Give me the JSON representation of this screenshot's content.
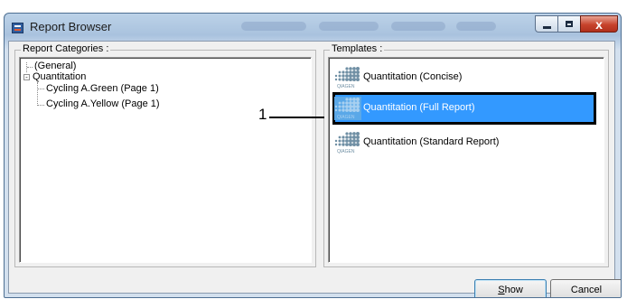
{
  "window": {
    "title": "Report Browser",
    "close_glyph": "x"
  },
  "categories": {
    "legend": "Report Categories :",
    "items": [
      {
        "label": "(General)"
      },
      {
        "label": "Quantitation",
        "expander": "-"
      },
      {
        "label": "Cycling A.Green (Page 1)"
      },
      {
        "label": "Cycling A.Yellow (Page 1)"
      }
    ]
  },
  "templates": {
    "legend": "Templates :",
    "items": [
      {
        "label": "Quantitation (Concise)",
        "selected": false,
        "logo": "QIAGEN"
      },
      {
        "label": "Quantitation (Full Report)",
        "selected": true,
        "logo": "QIAGEN"
      },
      {
        "label": "Quantitation (Standard Report)",
        "selected": false,
        "logo": "QIAGEN"
      }
    ]
  },
  "callout": {
    "number": "1"
  },
  "buttons": {
    "show_mnemonic": "S",
    "show_rest": "how",
    "cancel": "Cancel"
  },
  "colors": {
    "selection": "#3399ff",
    "close_button": "#c7432c",
    "dialog_face": "#f0f0f0"
  },
  "icons": [
    "window-app-icon",
    "minimize-icon",
    "maximize-icon",
    "close-icon",
    "template-icon"
  ]
}
